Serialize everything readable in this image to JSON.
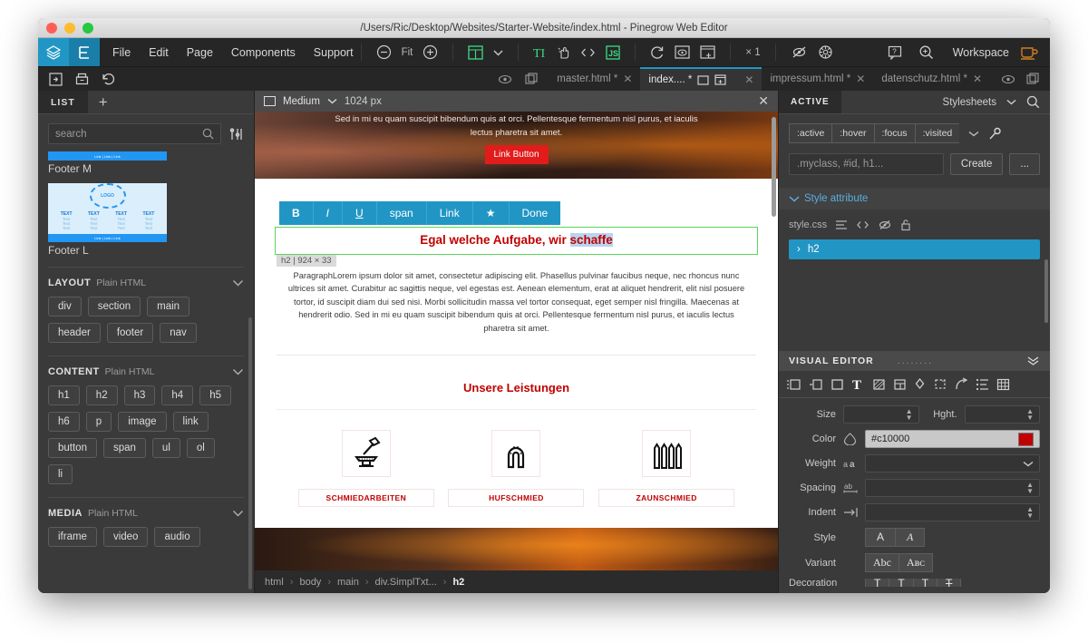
{
  "window": {
    "title": "/Users/Ric/Desktop/Websites/Starter-Website/index.html - Pinegrow Web Editor"
  },
  "menubar": {
    "items": [
      "File",
      "Edit",
      "Page",
      "Components",
      "Support"
    ],
    "zoom_fit_label": "Fit",
    "multiplier_label": "× 1",
    "workspace_label": "Workspace",
    "icons": [
      "minus-circle-icon",
      "plus-circle-icon",
      "grid-select-icon",
      "chevron-down-icon",
      "text-cursor-icon",
      "hand-click-icon",
      "code-brackets-icon",
      "js-icon",
      "refresh-icon",
      "preview-icon",
      "open-in-window-icon",
      "eye-slash-icon",
      "bug-icon",
      "help-icon",
      "magnify-icon",
      "coffee-cup-icon"
    ]
  },
  "toolbar2": {
    "icons": [
      "export-icon",
      "save-icon",
      "undo-icon",
      "eye-icon",
      "duplicate-icon"
    ]
  },
  "tabs": [
    {
      "label": "master.html *",
      "active": false
    },
    {
      "label": "index.... *",
      "active": true
    },
    {
      "label": "impressum.html *",
      "active": false
    },
    {
      "label": "datenschutz.html *",
      "active": false
    }
  ],
  "left_panel": {
    "tab_label": "LIST",
    "add_label": "+",
    "search_placeholder": "search",
    "thumbnails": [
      {
        "label": "Footer M",
        "bar_text": "Link | Link | Link"
      },
      {
        "label": "Footer L",
        "logo_text": "LOGO",
        "columns": [
          "TEXT",
          "TEXT",
          "TEXT",
          "TEXT"
        ],
        "column_lines": [
          "Text",
          "Text",
          "Text"
        ],
        "bar_text": "Link | Link | Link"
      }
    ],
    "sections": [
      {
        "name": "LAYOUT",
        "subtitle": "Plain HTML",
        "chips": [
          "div",
          "section",
          "main",
          "header",
          "footer",
          "nav"
        ]
      },
      {
        "name": "CONTENT",
        "subtitle": "Plain HTML",
        "chips": [
          "h1",
          "h2",
          "h3",
          "h4",
          "h5",
          "h6",
          "p",
          "image",
          "link",
          "button",
          "span",
          "ul",
          "ol",
          "li"
        ]
      },
      {
        "name": "MEDIA",
        "subtitle": "Plain HTML",
        "chips": [
          "iframe",
          "video",
          "audio"
        ]
      }
    ]
  },
  "canvas": {
    "viewport_label": "Medium",
    "viewport_width": "1024 px",
    "close_label": "✕",
    "hero": {
      "text": "Sed in mi eu quam suscipit bibendum quis at orci. Pellentesque fermentum nisl purus, et iaculis lectus pharetra sit amet.",
      "button_label": "Link Button"
    },
    "inline_toolbar": [
      "B",
      "I",
      "U",
      "span",
      "Link",
      "★",
      "Done"
    ],
    "heading": {
      "text_before": "Egal welche Aufgabe, wir ",
      "text_selected": "schaffe",
      "badge": "h2 | 924 × 33"
    },
    "paragraph": "ParagraphLorem ipsum dolor sit amet, consectetur adipiscing elit. Phasellus pulvinar faucibus neque, nec rhoncus nunc ultrices sit amet. Curabitur ac sagittis neque, vel egestas est. Aenean elementum, erat at aliquet hendrerit, elit nisl posuere tortor, id suscipit diam dui sed nisi. Morbi sollicitudin massa vel tortor consequat, eget semper nisl fringilla. Maecenas at hendrerit odio. Sed in mi eu quam suscipit bibendum quis at orci. Pellentesque fermentum nisl purus, et iaculis lectus pharetra sit amet.",
    "services_title": "Unsere Leistungen",
    "services": [
      {
        "name": "SCHMIEDARBEITEN",
        "icon": "anvil-hammer-icon"
      },
      {
        "name": "HUFSCHMIED",
        "icon": "horseshoe-icon"
      },
      {
        "name": "ZAUNSCHMIED",
        "icon": "fence-icon"
      }
    ]
  },
  "breadcrumb": [
    "html",
    "body",
    "main",
    "div.SimplTxt...",
    "h2"
  ],
  "right_panel": {
    "tab_label": "ACTIVE",
    "stylesheets_label": "Stylesheets",
    "pseudo_classes": [
      ":active",
      ":hover",
      ":focus",
      ":visited"
    ],
    "selector_placeholder": ".myclass, #id, h1...",
    "create_label": "Create",
    "more_label": "...",
    "style_attribute_label": "Style attribute",
    "stylesheet_file": "style.css",
    "selected_rule": "h2",
    "visual_editor": {
      "title": "VISUAL EDITOR",
      "dots": "........",
      "icon_row": [
        "margin-icon",
        "padding-icon",
        "box-icon",
        "typography-icon",
        "background-icon",
        "layout-icon",
        "shadow-icon",
        "transform-icon",
        "transition-icon",
        "list-icon",
        "table-icon"
      ],
      "fields": [
        {
          "label": "Size",
          "value": "",
          "icon": "",
          "type": "spinner"
        },
        {
          "label": "Hght.",
          "value": "",
          "icon": "",
          "type": "spinner"
        },
        {
          "label": "Color",
          "value": "#c10000",
          "icon": "color-icon",
          "type": "color",
          "swatch": "#c10000"
        },
        {
          "label": "Weight",
          "value": "",
          "icon": "aa-icon",
          "type": "select"
        },
        {
          "label": "Spacing",
          "value": "",
          "icon": "ab-icon",
          "type": "spinner"
        },
        {
          "label": "Indent",
          "value": "",
          "icon": "indent-icon",
          "type": "spinner"
        },
        {
          "label": "Style",
          "value": "",
          "icon": "",
          "type": "segmented",
          "options": [
            "A",
            "A"
          ]
        },
        {
          "label": "Variant",
          "value": "",
          "icon": "",
          "type": "segmented",
          "options": [
            "Abc",
            "Aʙᴄ"
          ]
        },
        {
          "label": "Decoration",
          "value": "",
          "icon": "",
          "type": "segmented",
          "options": [
            "T",
            "T",
            "T",
            "T"
          ]
        }
      ]
    }
  },
  "colors": {
    "accent_blue": "#2196c4",
    "brand_red": "#c10000",
    "button_red": "#e21b1b",
    "panel_bg": "#3a3a3a",
    "dark_bg": "#2b2b2b"
  }
}
